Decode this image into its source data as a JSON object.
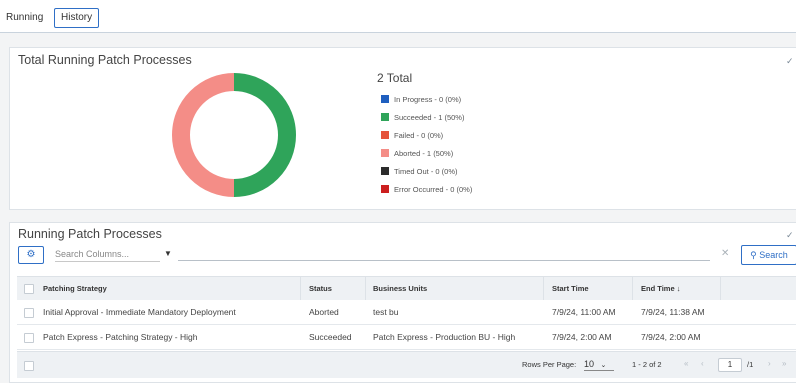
{
  "tabs": {
    "running": "Running",
    "history": "History"
  },
  "summary": {
    "title": "Total Running Patch Processes",
    "total": "2 Total",
    "legend": [
      {
        "label": "In Progress - 0 (0%)",
        "color": "#1f5fbf"
      },
      {
        "label": "Succeeded - 1 (50%)",
        "color": "#2fa45a"
      },
      {
        "label": "Failed - 0 (0%)",
        "color": "#e5533a"
      },
      {
        "label": "Aborted - 1 (50%)",
        "color": "#f48d87"
      },
      {
        "label": "Timed Out - 0 (0%)",
        "color": "#2b2b2b"
      },
      {
        "label": "Error Occurred - 0 (0%)",
        "color": "#cc1f1f"
      }
    ]
  },
  "chart_data": {
    "type": "pie",
    "donut": true,
    "categories": [
      "In Progress",
      "Succeeded",
      "Failed",
      "Aborted",
      "Timed Out",
      "Error Occurred"
    ],
    "values": [
      0,
      1,
      0,
      1,
      0,
      0
    ],
    "colors": [
      "#1f5fbf",
      "#2fa45a",
      "#e5533a",
      "#f48d87",
      "#2b2b2b",
      "#cc1f1f"
    ],
    "title": "Total Running Patch Processes"
  },
  "processes": {
    "title": "Running Patch Processes",
    "search_placeholder": "Search Columns...",
    "search_label": "Search",
    "columns": [
      "Patching Strategy",
      "Status",
      "Business Units",
      "Start Time",
      "End Time"
    ],
    "rows": [
      [
        "Initial Approval - Immediate Mandatory Deployment",
        "Aborted",
        "test bu",
        "7/9/24, 11:00 AM",
        "7/9/24, 11:38 AM"
      ],
      [
        "Patch Express - Patching Strategy - High",
        "Succeeded",
        "Patch Express - Production BU - High",
        "7/9/24, 2:00 AM",
        "7/9/24, 2:00 AM"
      ]
    ]
  },
  "pagination": {
    "rows_per_page_label": "Rows Per Page:",
    "rows_per_page": "10",
    "range": "1 - 2 of 2",
    "page": "1",
    "page_total": "/1"
  }
}
